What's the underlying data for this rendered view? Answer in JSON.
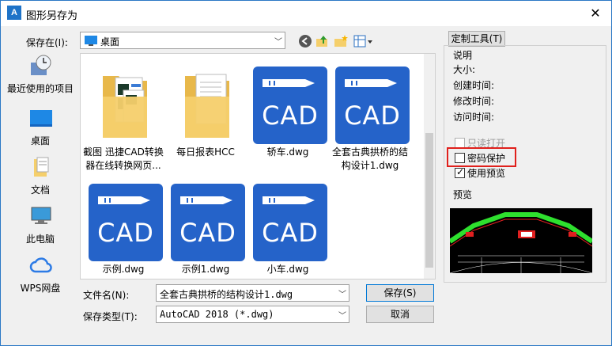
{
  "window": {
    "title": "图形另存为",
    "app_icon_text": "A"
  },
  "save_in": {
    "label": "保存在(I):",
    "value": "桌面"
  },
  "places": [
    {
      "label": "最近使用的项目",
      "icon": "recent-icon"
    },
    {
      "label": "桌面",
      "icon": "desktop-icon"
    },
    {
      "label": "文档",
      "icon": "documents-icon"
    },
    {
      "label": "此电脑",
      "icon": "computer-icon"
    },
    {
      "label": "WPS网盘",
      "icon": "cloud-icon"
    }
  ],
  "files": [
    {
      "name": "截图 迅捷CAD转换器在线转换网页...",
      "type": "folder"
    },
    {
      "name": "每日报表HCC",
      "type": "folder"
    },
    {
      "name": "轿车.dwg",
      "type": "cad"
    },
    {
      "name": "全套古典拱桥的结构设计1.dwg",
      "type": "cad"
    },
    {
      "name": "示例.dwg",
      "type": "cad"
    },
    {
      "name": "示例1.dwg",
      "type": "cad"
    },
    {
      "name": "小车.dwg",
      "type": "cad"
    }
  ],
  "cad_text": "CAD",
  "filename": {
    "label": "文件名(N):",
    "value": "全套古典拱桥的结构设计1.dwg"
  },
  "filetype": {
    "label": "保存类型(T):",
    "value": "AutoCAD 2018 (*.dwg)"
  },
  "buttons": {
    "save": "保存(S)",
    "cancel": "取消",
    "tools": "定制工具(T)"
  },
  "info": {
    "heading": "说明",
    "size": "大小:",
    "created": "创建时间:",
    "modified": "修改时间:",
    "accessed": "访问时间:"
  },
  "options": {
    "readonly": {
      "label": "只读打开",
      "checked": false,
      "enabled": false
    },
    "password": {
      "label": "密码保护",
      "checked": false,
      "enabled": true
    },
    "preview": {
      "label": "使用预览",
      "checked": true,
      "enabled": true
    }
  },
  "preview_label": "预览",
  "colors": {
    "accent": "#2563c9",
    "highlight": "#e0201c",
    "folder": "#f5cf6b"
  }
}
